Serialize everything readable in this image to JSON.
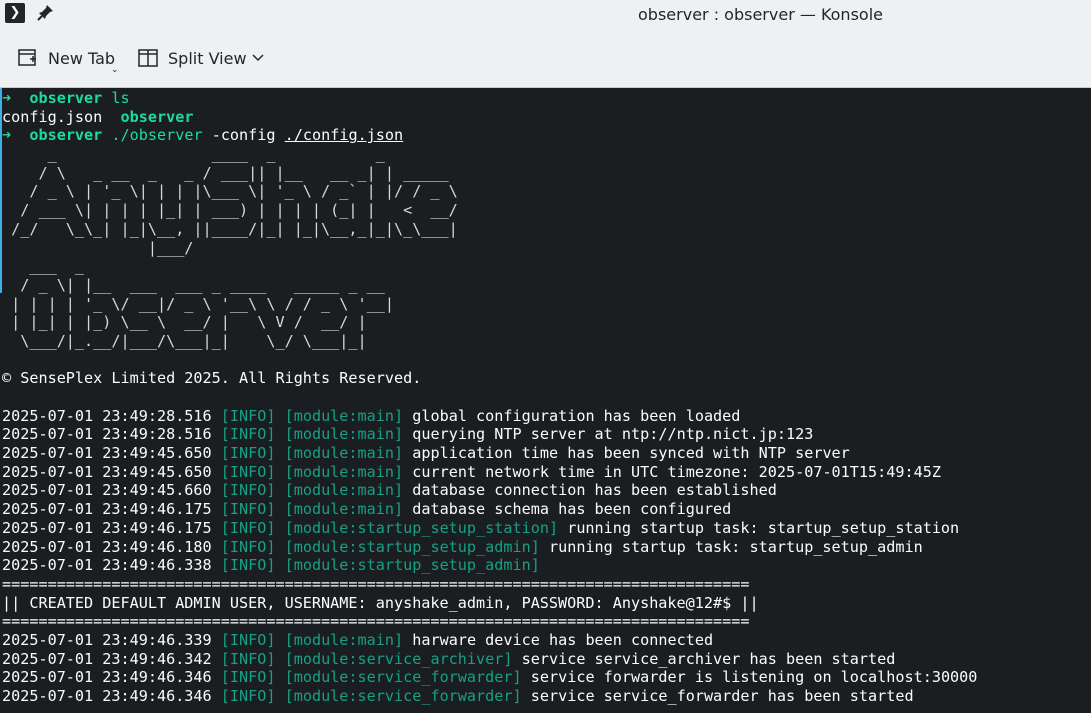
{
  "window": {
    "title": "observer : observer — Konsole",
    "app_icon": "terminal-icon",
    "pin_icon": "pin-icon"
  },
  "toolbar": {
    "new_tab_label": "New Tab",
    "split_view_label": "Split View",
    "new_tab_icon": "new-tab-icon",
    "split_view_icon": "split-view-icon",
    "menu_icon": "chevron-down-icon"
  },
  "terminal": {
    "prompt_arrow": "➜",
    "cmd1": {
      "dir": "observer",
      "cmd": "ls"
    },
    "ls_output": {
      "file1": "config.json",
      "file2": "observer"
    },
    "cmd2": {
      "dir": "observer",
      "exe": "./observer",
      "flag": "-config",
      "arg": "./config.json"
    },
    "banner_art": [
      "     _                 ____  _           _",
      "    / \\   _ __  _   _ / ___|| |__   __ _| | _____",
      "   / _ \\ | '_ \\| | | |\\___ \\| '_ \\ / _` | |/ / _ \\",
      "  / ___ \\| | | | |_| | ___) | | | | (_| |   <  __/",
      " /_/   \\_\\_| |_|\\__, ||____/|_| |_|\\__,_|_|\\_\\___|",
      "                |___/",
      "   ___  _",
      "  / _ \\| |__  ___  ___ _ ____   _____ _ __",
      " | | | | '_ \\/ __|/ _ \\ '__\\ \\ / / _ \\ '__|",
      " | |_| | |_) \\__ \\  __/ |   \\ V /  __/ |",
      "  \\___/|_.__/|___/\\___|_|    \\_/ \\___|_|"
    ],
    "copyright": "© SensePlex Limited 2025. All Rights Reserved.",
    "logs_a": [
      {
        "ts": "2025-07-01 23:49:28.516",
        "level": "[INFO]",
        "module": "[module:main]",
        "msg": "global configuration has been loaded"
      },
      {
        "ts": "2025-07-01 23:49:28.516",
        "level": "[INFO]",
        "module": "[module:main]",
        "msg": "querying NTP server at ntp://ntp.nict.jp:123"
      },
      {
        "ts": "2025-07-01 23:49:45.650",
        "level": "[INFO]",
        "module": "[module:main]",
        "msg": "application time has been synced with NTP server"
      },
      {
        "ts": "2025-07-01 23:49:45.650",
        "level": "[INFO]",
        "module": "[module:main]",
        "msg": "current network time in UTC timezone: 2025-07-01T15:49:45Z"
      },
      {
        "ts": "2025-07-01 23:49:45.660",
        "level": "[INFO]",
        "module": "[module:main]",
        "msg": "database connection has been established"
      },
      {
        "ts": "2025-07-01 23:49:46.175",
        "level": "[INFO]",
        "module": "[module:main]",
        "msg": "database schema has been configured"
      },
      {
        "ts": "2025-07-01 23:49:46.175",
        "level": "[INFO]",
        "module": "[module:startup_setup_station]",
        "msg": "running startup task: startup_setup_station"
      },
      {
        "ts": "2025-07-01 23:49:46.180",
        "level": "[INFO]",
        "module": "[module:startup_setup_admin]",
        "msg": "running startup task: startup_setup_admin"
      },
      {
        "ts": "2025-07-01 23:49:46.338",
        "level": "[INFO]",
        "module": "[module:startup_setup_admin]",
        "msg": ""
      }
    ],
    "separator": "==================================================================================",
    "admin_notice": "|| CREATED DEFAULT ADMIN USER, USERNAME: anyshake_admin, PASSWORD: Anyshake@12#$ ||",
    "logs_b": [
      {
        "ts": "2025-07-01 23:49:46.339",
        "level": "[INFO]",
        "module": "[module:main]",
        "msg": "harware device has been connected"
      },
      {
        "ts": "2025-07-01 23:49:46.342",
        "level": "[INFO]",
        "module": "[module:service_archiver]",
        "msg": "service service_archiver has been started"
      },
      {
        "ts": "2025-07-01 23:49:46.346",
        "level": "[INFO]",
        "module": "[module:service_forwarder]",
        "msg": "service forwarder is listening on localhost:30000"
      },
      {
        "ts": "2025-07-01 23:49:46.346",
        "level": "[INFO]",
        "module": "[module:service_forwarder]",
        "msg": "service service_forwarder has been started"
      }
    ]
  },
  "colors": {
    "terminal_bg": "#1b1e20",
    "prompt_green": "#1cdc9a",
    "info_cyan": "#16a085",
    "chrome_bg": "#eff0f1"
  }
}
